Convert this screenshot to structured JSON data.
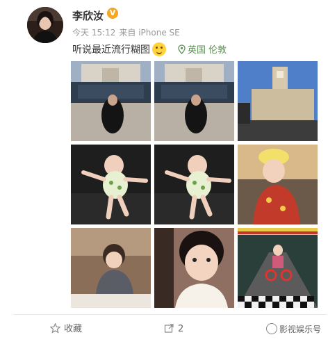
{
  "user": {
    "name": "李欣汝",
    "verified_badge": "V"
  },
  "meta": {
    "time": "今天 15:12",
    "source": "来自 iPhone SE"
  },
  "post": {
    "text": "听说最近流行糊图",
    "emoji": "smile-emoji",
    "location": "英国 伦敦"
  },
  "photos": [
    {
      "name": "photo-street-building"
    },
    {
      "name": "photo-street-building-2"
    },
    {
      "name": "photo-london-clocktower"
    },
    {
      "name": "photo-baby-on-sofa"
    },
    {
      "name": "photo-baby-on-sofa-2"
    },
    {
      "name": "photo-baby-flower-hat"
    },
    {
      "name": "photo-baby-cafe"
    },
    {
      "name": "photo-baby-selfie"
    },
    {
      "name": "photo-baby-tricycle"
    }
  ],
  "actions": {
    "favorite": "收藏",
    "repost": "2"
  },
  "watermark": "影视娱乐号",
  "colors": {
    "accent_green": "#5b8f52",
    "badge": "#f5a623"
  }
}
